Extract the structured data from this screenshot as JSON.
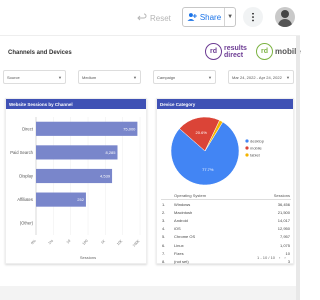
{
  "toolbar": {
    "reset_label": "Reset",
    "share_label": "Share"
  },
  "report": {
    "title": "Channels and Devices",
    "logos": {
      "primary": {
        "badge": "rd",
        "line1": "results",
        "line2": "direct"
      },
      "secondary": {
        "badge": "rd",
        "line1": "mobile"
      }
    },
    "filters": [
      {
        "label": "Source"
      },
      {
        "label": "Medium"
      },
      {
        "label": "Campaign"
      },
      {
        "label": "Mar 24, 2022 - Apr 24, 2022"
      }
    ]
  },
  "sessions_panel": {
    "title": "Website Sessions by Channel",
    "xlabel": "Sessions"
  },
  "device_panel": {
    "title": "Device Category"
  },
  "chart_data": [
    {
      "type": "bar",
      "title": "Website Sessions by Channel",
      "orientation": "horizontal",
      "categories": [
        "Direct",
        "Paid Search",
        "Display",
        "Affiliates",
        "(Other)"
      ],
      "values": [
        75000,
        8285,
        4539,
        252,
        0
      ],
      "value_labels": [
        "75,000",
        "8,285",
        "4,539",
        "252",
        ""
      ],
      "xlabel": "Sessions",
      "xticks": [
        "0%",
        "1%",
        "10",
        "100",
        "1K",
        "10K",
        "100K"
      ],
      "color": "#7986cb"
    },
    {
      "type": "pie",
      "title": "Device Category",
      "labels": [
        "desktop",
        "mobile",
        "tablet"
      ],
      "values": [
        77.7,
        20.6,
        1.7
      ],
      "value_labels": [
        "77.7%",
        "20.6%",
        ""
      ],
      "colors": [
        "#4285f4",
        "#db4437",
        "#f4b400"
      ],
      "legend": "right"
    }
  ],
  "os_table": {
    "headers": [
      "",
      "Operating System",
      "Sessions"
    ],
    "rows": [
      [
        "1.",
        "Windows",
        "36,456"
      ],
      [
        "2.",
        "Macintosh",
        "21,500"
      ],
      [
        "3.",
        "Android",
        "14,017"
      ],
      [
        "4.",
        "iOS",
        "12,950"
      ],
      [
        "5.",
        "Chrome OS",
        "7,957"
      ],
      [
        "6.",
        "Linux",
        "1,075"
      ],
      [
        "7.",
        "Fizes",
        "10"
      ],
      [
        "8.",
        "(not set)",
        "3"
      ]
    ],
    "pager_text": "1 - 10 / 10"
  }
}
